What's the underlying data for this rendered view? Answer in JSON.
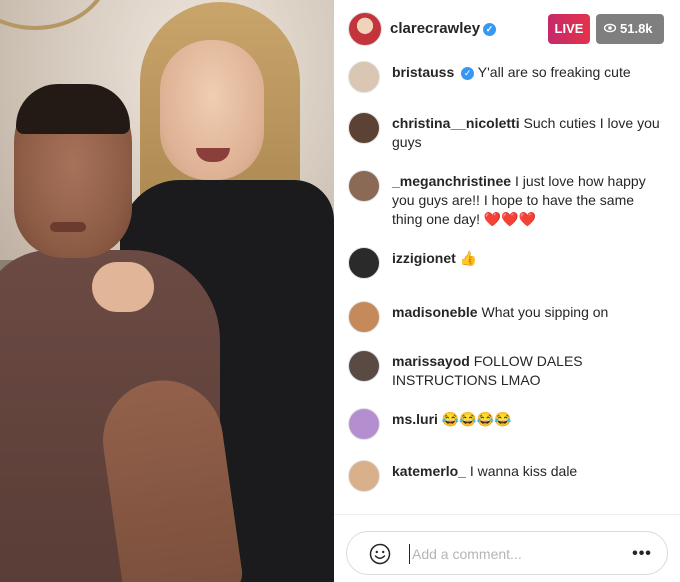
{
  "header": {
    "host_username": "clarecrawley",
    "verified_icon": "verified-badge-icon",
    "live_label": "LIVE",
    "viewer_count": "51.8k",
    "eye_icon": "eye-icon",
    "colors": {
      "live": "#e3334a",
      "verified": "#3897f0",
      "viewers_bg": "#7f7f7f"
    }
  },
  "comments": [
    {
      "user": "bristauss",
      "verified": true,
      "text": "Y'all are so freaking cute",
      "avatar_color": "#d9c7b3"
    },
    {
      "user": "christina__nicoletti",
      "verified": false,
      "text": "Such cuties I love you guys",
      "avatar_color": "#5b4235"
    },
    {
      "user": "_meganchristinee",
      "verified": false,
      "text": "I just love how happy you guys are!! I hope to have the same thing one day! ❤️❤️❤️",
      "avatar_color": "#8a6a55"
    },
    {
      "user": "izzigionet",
      "verified": false,
      "text": "👍",
      "avatar_color": "#2a2a2a"
    },
    {
      "user": "madisoneble",
      "verified": false,
      "text": "What you sipping on",
      "avatar_color": "#c48a5b"
    },
    {
      "user": "marissayod",
      "verified": false,
      "text": "FOLLOW DALES INSTRUCTIONS LMAO",
      "avatar_color": "#5a4a44"
    },
    {
      "user": "ms.luri",
      "verified": false,
      "text": "😂😂😂😂",
      "avatar_color": "#b48fd0"
    },
    {
      "user": "katemerlo_",
      "verified": false,
      "text": "I wanna kiss dale",
      "avatar_color": "#d8b08b"
    }
  ],
  "footer": {
    "comment_placeholder": "Add a comment...",
    "emoji_icon": "smile-icon",
    "more_icon": "more-options-icon",
    "more_label": "•••"
  },
  "video": {
    "description_icon": "live-video-feed"
  }
}
